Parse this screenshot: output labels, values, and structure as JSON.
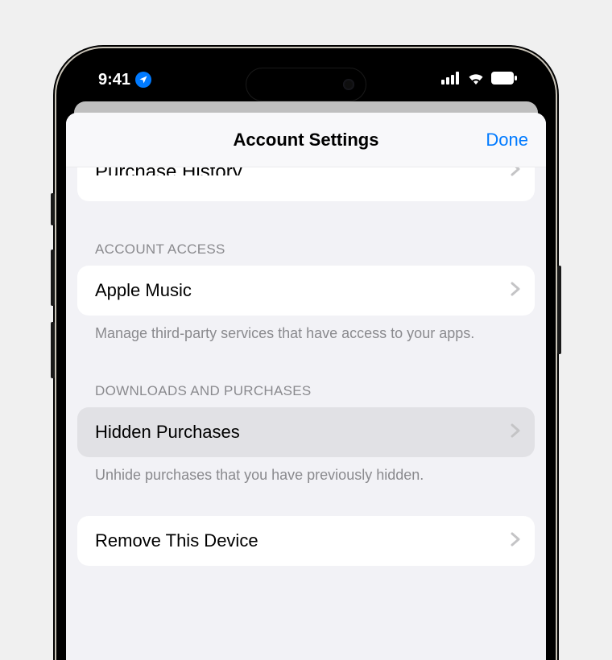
{
  "status": {
    "time": "9:41"
  },
  "nav": {
    "title": "Account Settings",
    "done": "Done"
  },
  "cutoffRow": {
    "label": "Purchase History"
  },
  "section1": {
    "header": "ACCOUNT ACCESS",
    "item": "Apple Music",
    "footer": "Manage third-party services that have access to your apps."
  },
  "section2": {
    "header": "DOWNLOADS AND PURCHASES",
    "item": "Hidden Purchases",
    "footer": "Unhide purchases that you have previously hidden."
  },
  "section3": {
    "item": "Remove This Device"
  }
}
